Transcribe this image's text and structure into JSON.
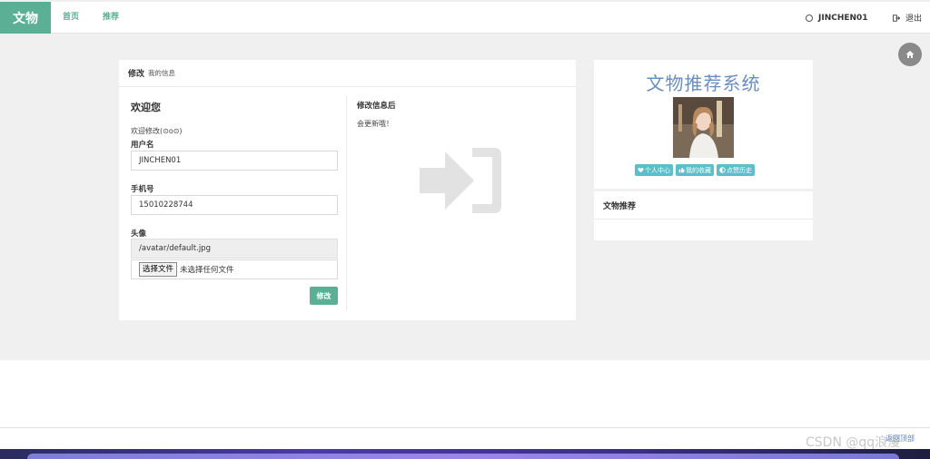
{
  "nav": {
    "brand": "文物",
    "home": "首页",
    "recommend": "推荐",
    "username": "JINCHEN01",
    "logout": "退出"
  },
  "panel": {
    "title": "修改",
    "subtitle": "我的信息",
    "welcome_title": "欢迎您",
    "welcome_text": "欢迎修改(⊙o⊙)",
    "username_label": "用户名",
    "username_value": "JINCHEN01",
    "phone_label": "手机号",
    "phone_value": "15010228744",
    "avatar_label": "头像",
    "avatar_path": "/avatar/default.jpg",
    "file_button": "选择文件",
    "file_status": "未选择任何文件",
    "submit": "修改",
    "info_title": "修改信息后",
    "info_text": "会更新哦！"
  },
  "sidebar": {
    "system_title": "文物推荐系统",
    "tags": [
      "个人中心",
      "我的收藏",
      "点赞历史"
    ],
    "recommend_title": "文物推荐"
  },
  "footer": {
    "text": "返回顶部",
    "watermark": "CSDN @qq浪漫"
  },
  "colors": {
    "brand": "#5aaf94",
    "tag": "#5bbec9",
    "title_blue": "#6a8ebf"
  }
}
